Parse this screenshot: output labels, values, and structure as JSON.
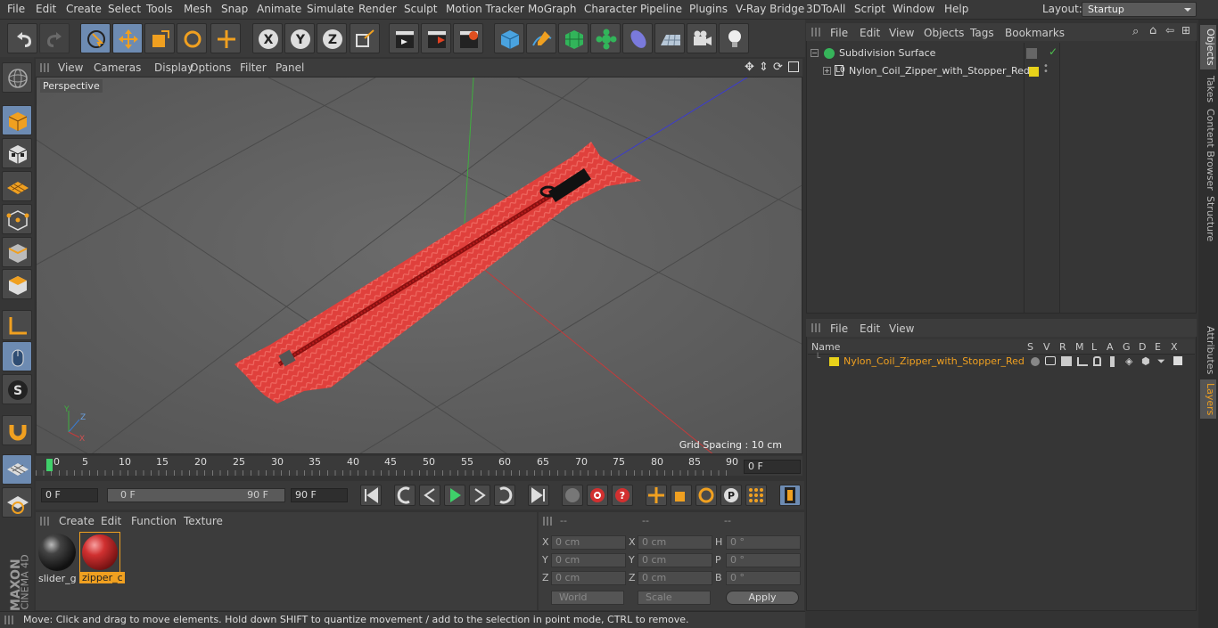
{
  "menubar": {
    "items": [
      "File",
      "Edit",
      "Create",
      "Select",
      "Tools",
      "Mesh",
      "Snap",
      "Animate",
      "Simulate",
      "Render",
      "Sculpt",
      "Motion Tracker",
      "MoGraph",
      "Character",
      "Pipeline",
      "Plugins",
      "V-Ray Bridge",
      "3DToAll",
      "Script",
      "Window",
      "Help"
    ],
    "layout_label": "Layout:",
    "layout_value": "Startup"
  },
  "viewport": {
    "menu": [
      "View",
      "Cameras",
      "Display",
      "Options",
      "Filter",
      "Panel"
    ],
    "camera_label": "Perspective",
    "grid_spacing": "Grid Spacing : 10 cm"
  },
  "timeline": {
    "ticks": [
      "0",
      "5",
      "10",
      "15",
      "20",
      "25",
      "30",
      "35",
      "40",
      "45",
      "50",
      "55",
      "60",
      "65",
      "70",
      "75",
      "80",
      "85",
      "90"
    ],
    "current_frame": "0 F",
    "start_field": "0 F",
    "range_start": "0 F",
    "range_end": "90 F",
    "end_field": "90 F"
  },
  "material_manager": {
    "menu": [
      "Create",
      "Edit",
      "Function",
      "Texture"
    ],
    "materials": [
      {
        "name": "slider_g",
        "color": "#2a2a2a"
      },
      {
        "name": "zipper_c",
        "color": "#c62828"
      }
    ]
  },
  "coordinates": {
    "headers": [
      "--",
      "--",
      "--"
    ],
    "rows": [
      {
        "l1": "X",
        "v1": "0 cm",
        "l2": "X",
        "v2": "0 cm",
        "l3": "H",
        "v3": "0 °"
      },
      {
        "l1": "Y",
        "v1": "0 cm",
        "l2": "Y",
        "v2": "0 cm",
        "l3": "P",
        "v3": "0 °"
      },
      {
        "l1": "Z",
        "v1": "0 cm",
        "l2": "Z",
        "v2": "0 cm",
        "l3": "B",
        "v3": "0 °"
      }
    ],
    "world": "World",
    "scale": "Scale",
    "apply": "Apply"
  },
  "status": "Move: Click and drag to move elements. Hold down SHIFT to quantize movement / add to the selection in point mode, CTRL to remove.",
  "object_manager": {
    "menu": [
      "File",
      "Edit",
      "View",
      "Objects",
      "Tags",
      "Bookmarks"
    ],
    "objects": [
      {
        "name": "Subdivision Surface"
      },
      {
        "name": "Nylon_Coil_Zipper_with_Stopper_Red"
      }
    ]
  },
  "layer_manager": {
    "menu": [
      "File",
      "Edit",
      "View"
    ],
    "columns": [
      "Name",
      "S",
      "V",
      "R",
      "M",
      "L",
      "A",
      "G",
      "D",
      "E",
      "X"
    ],
    "layers": [
      {
        "name": "Nylon_Coil_Zipper_with_Stopper_Red",
        "color": "#e8d21a"
      }
    ]
  },
  "right_tabs": [
    "Objects",
    "Takes",
    "Content Browser",
    "Structure",
    "Attributes",
    "Layers"
  ],
  "brand": {
    "line1": "MAXON",
    "line2": "CINEMA 4D"
  }
}
